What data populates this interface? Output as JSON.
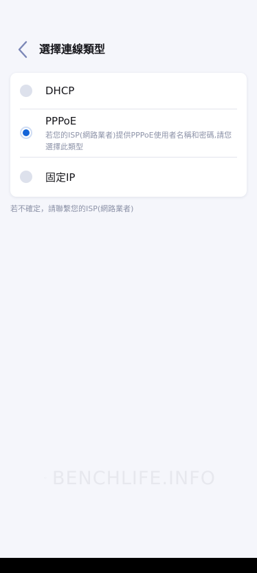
{
  "header": {
    "title": "選擇連線類型",
    "back_icon": "chevron-left-icon"
  },
  "options": [
    {
      "label": "DHCP",
      "selected": false
    },
    {
      "label": "PPPoE",
      "selected": true,
      "description": "若您的ISP(網路業者)提供PPPoE使用者名稱和密碼,請您選擇此類型"
    },
    {
      "label": "固定IP",
      "selected": false
    }
  ],
  "hint": "若不確定，請聯繫您的ISP(網路業者)",
  "watermark": "BENCHLIFE.INFO",
  "colors": {
    "accent": "#1565d8",
    "background": "#f5f6fb",
    "card": "#ffffff",
    "secondary_text": "#8d93a8"
  }
}
